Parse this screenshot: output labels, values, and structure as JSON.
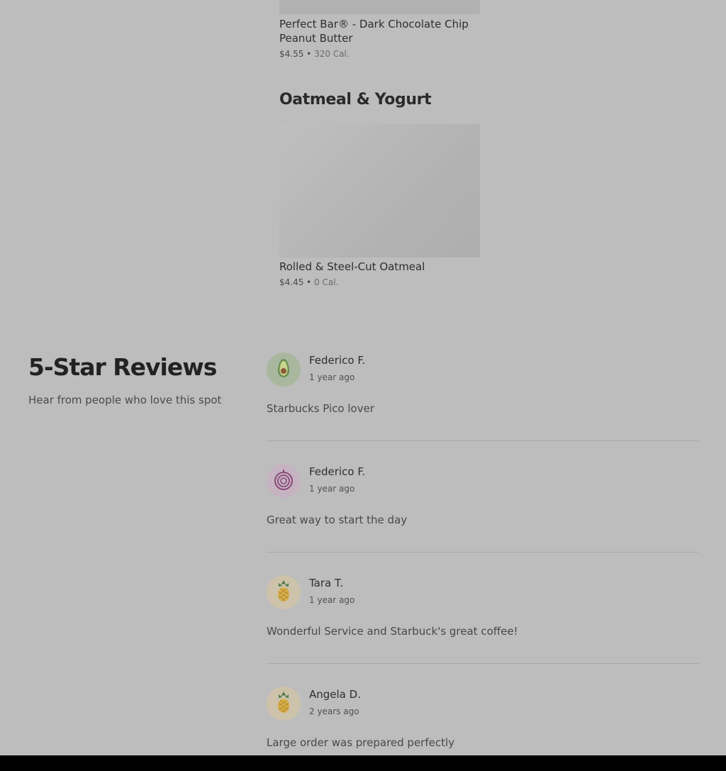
{
  "menu": {
    "top_item": {
      "name": "Perfect Bar® - Dark Chocolate Chip Peanut Butter",
      "price": "$4.55",
      "sep": " • ",
      "calories": "320 Cal."
    },
    "section_title": "Oatmeal & Yogurt",
    "oat_item": {
      "name": "Rolled & Steel-Cut Oatmeal",
      "price": "$4.45",
      "sep": " • ",
      "calories": "0 Cal."
    }
  },
  "reviews": {
    "title": "5-Star Reviews",
    "subtitle": "Hear from people who love this spot",
    "items": [
      {
        "name": "Federico F.",
        "time": "1 year ago",
        "text": "Starbucks Pico lover",
        "avatar_icon": "avocado-icon",
        "avatar_color": "#a9b79e"
      },
      {
        "name": "Federico F.",
        "time": "1 year ago",
        "text": "Great way to start the day",
        "avatar_icon": "onion-icon",
        "avatar_color": "#c5b3c2"
      },
      {
        "name": "Tara T.",
        "time": "1 year ago",
        "text": "Wonderful Service and Starbuck's great coffee!",
        "avatar_icon": "pineapple-icon",
        "avatar_color": "#cdc2aa"
      },
      {
        "name": "Angela D.",
        "time": "2 years ago",
        "text": "Large order was prepared perfectly",
        "avatar_icon": "pineapple-icon",
        "avatar_color": "#cdc2aa"
      }
    ]
  }
}
